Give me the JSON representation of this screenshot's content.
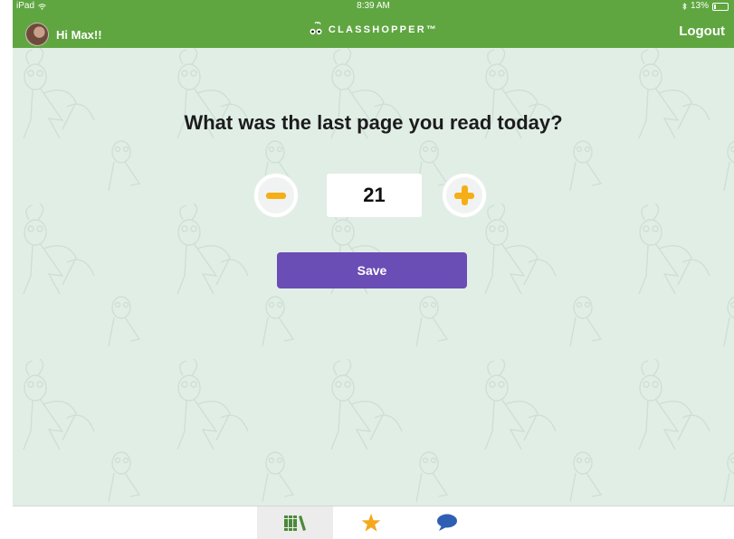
{
  "status_bar": {
    "device": "iPad",
    "time": "8:39 AM",
    "battery": "13%"
  },
  "header": {
    "greeting": "Hi Max!!",
    "brand": "CLASSHOPPER™",
    "logout_label": "Logout"
  },
  "main": {
    "question": "What was the last page you read today?",
    "page_value": "21",
    "save_label": "Save"
  },
  "tabs": [
    {
      "icon": "books-icon",
      "active": true
    },
    {
      "icon": "star-icon",
      "active": false
    },
    {
      "icon": "chat-bubble-icon",
      "active": false
    }
  ],
  "colors": {
    "header_green": "#5fa640",
    "background_mint": "#e1eee6",
    "stepper_orange": "#f5ae16",
    "save_purple": "#6a4db5",
    "books_green": "#4a8a3b",
    "star_orange": "#f5a81c",
    "chat_blue": "#2f5fb4"
  }
}
